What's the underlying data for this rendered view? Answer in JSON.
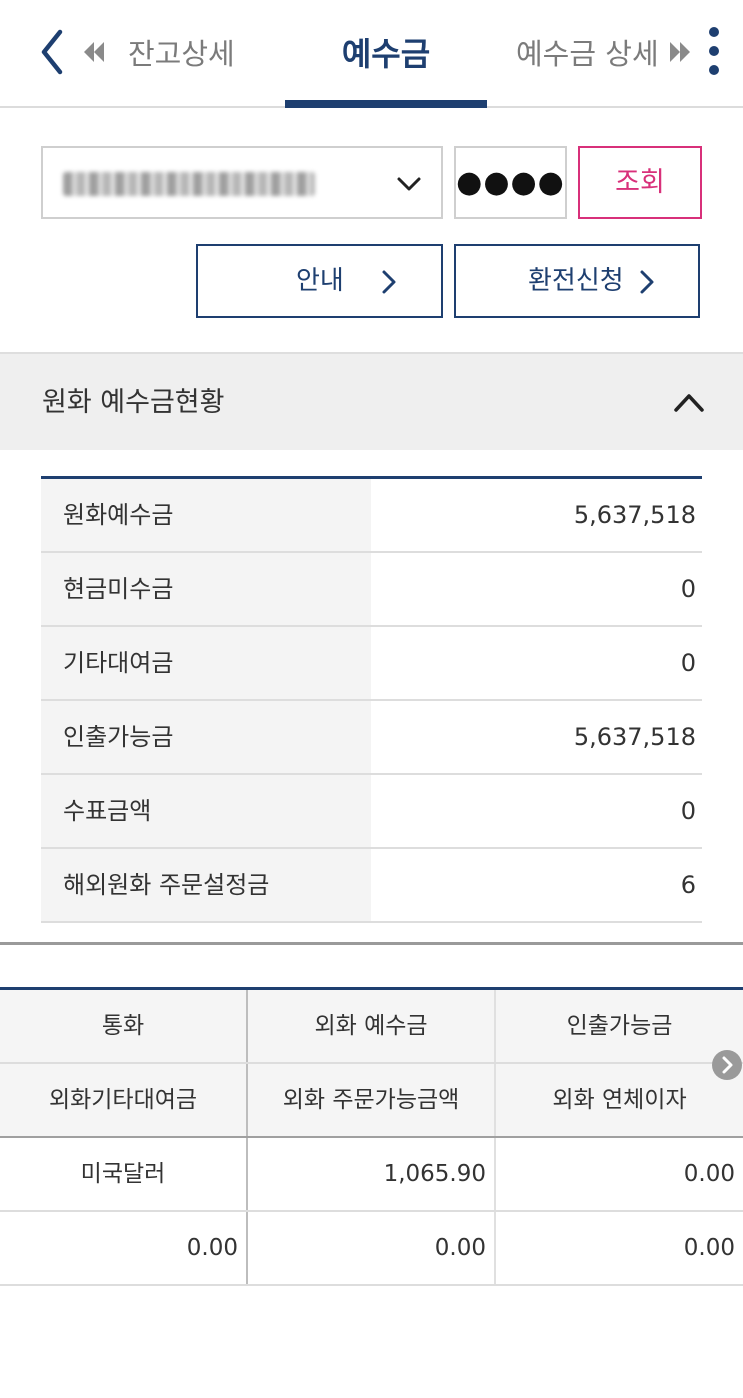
{
  "header": {
    "tabs": [
      {
        "label": "잔고상세"
      },
      {
        "label": "예수금"
      },
      {
        "label": "예수금 상세"
      }
    ]
  },
  "account": {
    "password_mask": "●●●●",
    "query_label": "조회"
  },
  "actions": {
    "guide_label": "안내",
    "exchange_label": "환전신청"
  },
  "krw_section": {
    "title": "원화 예수금현황",
    "rows": [
      {
        "label": "원화예수금",
        "value": "5,637,518"
      },
      {
        "label": "현금미수금",
        "value": "0"
      },
      {
        "label": "기타대여금",
        "value": "0"
      },
      {
        "label": "인출가능금",
        "value": "5,637,518"
      },
      {
        "label": "수표금액",
        "value": "0"
      },
      {
        "label": "해외원화 주문설정금",
        "value": "6"
      }
    ]
  },
  "fx_table": {
    "header_row1": [
      "통화",
      "외화 예수금",
      "인출가능금"
    ],
    "header_row2": [
      "외화기타대여금",
      "외화 주문가능금액",
      "외화 연체이자"
    ],
    "rows": [
      [
        "미국달러",
        "1,065.90",
        "0.00"
      ],
      [
        "0.00",
        "0.00",
        "0.00"
      ]
    ]
  },
  "colors": {
    "primary": "#1e3f70",
    "accent": "#d8307a",
    "muted_text": "#7b7b7b"
  },
  "icons": [
    "back-icon",
    "prev-arrows-icon",
    "next-arrows-icon",
    "more-icon",
    "chevron-down-icon",
    "chevron-right-icon",
    "chevron-up-icon",
    "scroll-right-icon"
  ]
}
